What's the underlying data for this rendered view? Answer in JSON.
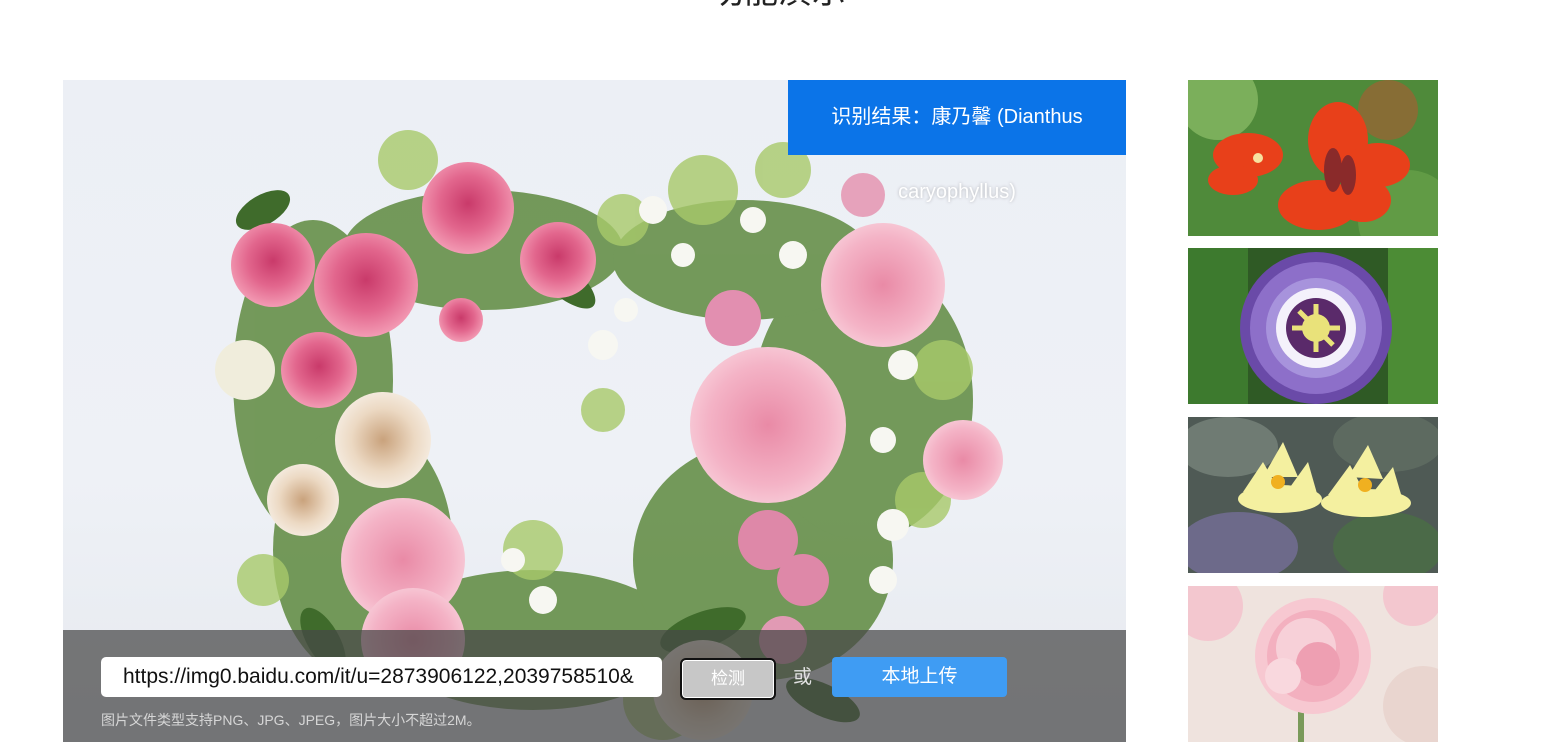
{
  "page": {
    "section_title": "功能演示"
  },
  "demo": {
    "image_alt": "heart-shaped wreath of pink roses and carnations",
    "result_line1": "识别结果：康乃馨 (Dianthus",
    "result_line2": "caryophyllus)",
    "url_value": "https://img0.baidu.com/it/u=2873906122,2039758510&",
    "detect_label": "检测",
    "or_label": "或",
    "upload_label": "本地上传",
    "hint": "图片文件类型支持PNG、JPG、JPEG，图片大小不超过2M。",
    "colors": {
      "result_bg": "#0b74e8",
      "upload_bg": "#3f9cf3",
      "detect_bg": "#c7c7c7",
      "bar_bg": "rgba(70,70,70,0.72)"
    }
  },
  "thumbnails": [
    {
      "name": "red wallflower",
      "icon": "flower-thumb"
    },
    {
      "name": "purple passion flower",
      "icon": "flower-thumb"
    },
    {
      "name": "yellow water lilies",
      "icon": "flower-thumb"
    },
    {
      "name": "pink carnation",
      "icon": "flower-thumb"
    }
  ]
}
